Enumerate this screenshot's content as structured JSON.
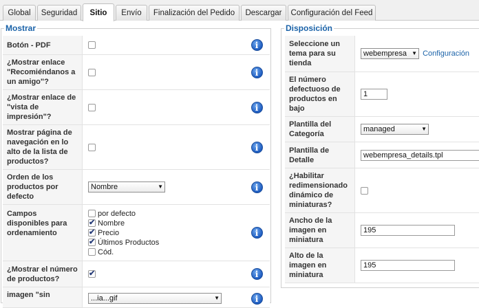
{
  "tabs": [
    {
      "label": "Global",
      "active": false
    },
    {
      "label": "Seguridad",
      "active": false
    },
    {
      "label": "Sitio",
      "active": true
    },
    {
      "label": "Envío",
      "active": false
    },
    {
      "label": "Finalización del Pedido",
      "active": false
    },
    {
      "label": "Descargar",
      "active": false
    },
    {
      "label": "Configuración del Feed",
      "active": false
    }
  ],
  "mostrar": {
    "legend": "Mostrar",
    "rows": {
      "pdf": {
        "label": "Botón - PDF",
        "checked": false
      },
      "recomendar": {
        "label": "¿Mostrar enlace \"Recomiéndanos a un amigo\"?",
        "checked": false
      },
      "impresion": {
        "label": "¿Mostrar enlace de \"vista de impresión\"?",
        "checked": false
      },
      "navegacion": {
        "label": "Mostrar página de navegación en lo alto de la lista de productos?",
        "checked": false
      },
      "orden": {
        "label": "Orden de los productos por defecto",
        "value": "Nombre"
      },
      "campos": {
        "label": "Campos disponibles para ordenamiento",
        "options": [
          {
            "label": "por defecto",
            "checked": false
          },
          {
            "label": "Nombre",
            "checked": true
          },
          {
            "label": "Precio",
            "checked": true
          },
          {
            "label": "Últimos Productos",
            "checked": true
          },
          {
            "label": "Cód.",
            "checked": false
          }
        ]
      },
      "numero": {
        "label": "¿Mostrar el número de productos?",
        "checked": true
      },
      "imagen": {
        "label": "imagen \"sin",
        "value": "...ia...gif"
      }
    },
    "info_glyph": "i"
  },
  "disposicion": {
    "legend": "Disposición",
    "rows": {
      "tema": {
        "label": "Seleccione un tema para su tienda",
        "value": "webempresa",
        "link": "Configuración"
      },
      "numero_productos": {
        "label": "El número defectuoso de productos en bajo",
        "value": "1"
      },
      "plantilla_categoria": {
        "label": "Plantilla del Categoría",
        "value": "managed"
      },
      "plantilla_detalle": {
        "label": "Plantilla de Detalle",
        "value": "webempresa_details.tpl"
      },
      "redimensionado": {
        "label": "¿Habilitar redimensionado dinámico de miniaturas?",
        "checked": false
      },
      "ancho": {
        "label": "Ancho de la imagen en miniatura",
        "value": "195"
      },
      "alto": {
        "label": "Alto de la imagen en miniatura",
        "value": "195"
      }
    }
  },
  "colors": {
    "legend": "#1a62a8",
    "info_icon": "#1e5cc0"
  },
  "icons": {
    "info": "info-icon",
    "checkbox": "checkbox-icon",
    "dropdown": "chevron-down-icon"
  }
}
